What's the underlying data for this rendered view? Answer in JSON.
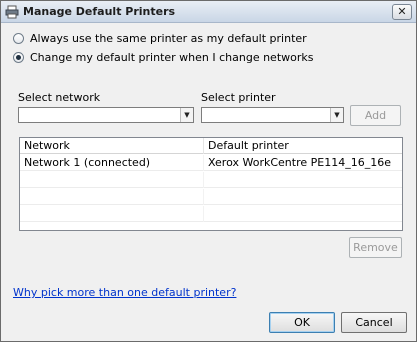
{
  "window": {
    "title": "Manage Default Printers",
    "close_glyph": "✕"
  },
  "options": {
    "always_same": {
      "label": "Always use the same printer as my default printer",
      "checked": false
    },
    "change_with_network": {
      "label": "Change my default printer when I change networks",
      "checked": true
    }
  },
  "selectors": {
    "network_label": "Select network",
    "network_value": "",
    "printer_label": "Select printer",
    "printer_value": "",
    "add_label": "Add"
  },
  "table": {
    "columns": [
      "Network",
      "Default printer"
    ],
    "rows": [
      {
        "network": "Network 1 (connected)",
        "printer": "Xerox WorkCentre PE114_16_16e"
      },
      {
        "network": "",
        "printer": ""
      },
      {
        "network": "",
        "printer": ""
      },
      {
        "network": "",
        "printer": ""
      },
      {
        "network": "",
        "printer": ""
      }
    ]
  },
  "remove_label": "Remove",
  "help_link": "Why pick more than one default printer?",
  "footer": {
    "ok_label": "OK",
    "cancel_label": "Cancel"
  },
  "colors": {
    "link": "#0033cc",
    "title_bar": "#c9d6e6",
    "background": "#f0f0f0"
  }
}
